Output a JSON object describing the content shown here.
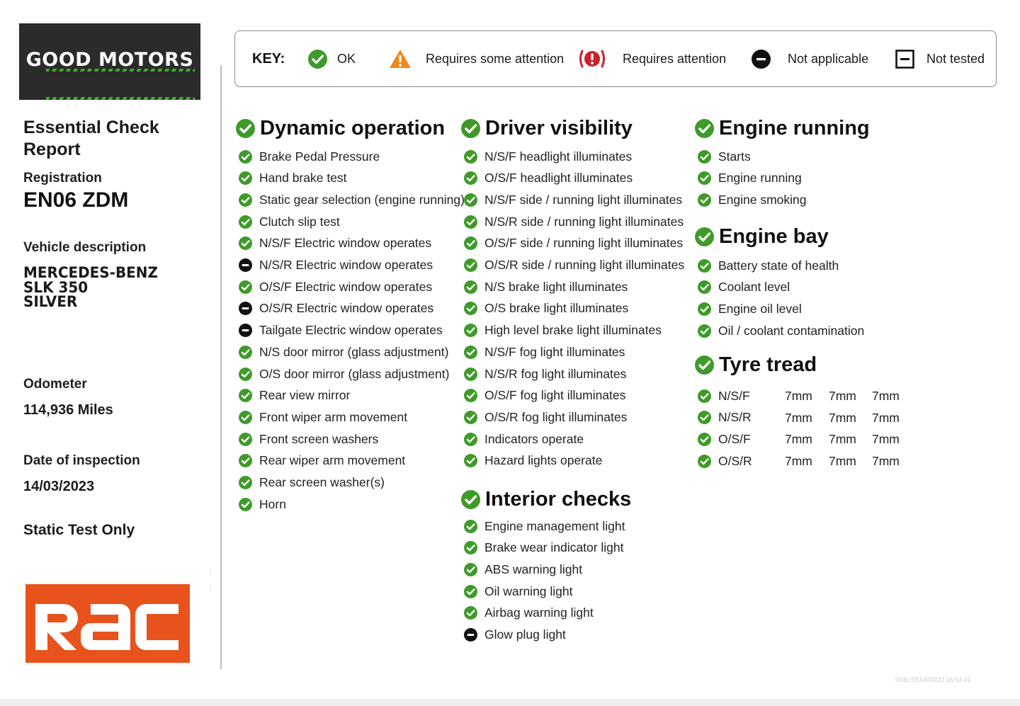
{
  "brand": {
    "logo_text": "GOOD MOTORS",
    "rac_logo_text": "RAC",
    "accent": "#3f9a2a",
    "rac_color": "#e8521c"
  },
  "report": {
    "title": "Essential Check Report",
    "registration_label": "Registration",
    "registration": "EN06 ZDM",
    "vehicle_label": "Vehicle description",
    "vehicle_lines": [
      "MERCEDES-BENZ",
      "SLK 350",
      "SILVER"
    ],
    "odometer_label": "Odometer",
    "odometer": "114,936 Miles",
    "date_label": "Date of inspection",
    "date": "14/03/2023",
    "test_type": "Static Test Only"
  },
  "key": {
    "title": "KEY:",
    "items": [
      {
        "icon": "ok-check-icon",
        "label": "OK"
      },
      {
        "icon": "warning-triangle-icon",
        "label": "Requires some attention"
      },
      {
        "icon": "alert-icon",
        "label": "Requires attention"
      },
      {
        "icon": "not-applicable-icon",
        "label": "Not applicable"
      },
      {
        "icon": "not-tested-icon",
        "label": "Not tested"
      }
    ]
  },
  "sections": {
    "dynamic": {
      "title": "Dynamic operation",
      "items": [
        {
          "label": "Brake Pedal Pressure",
          "status": "ok"
        },
        {
          "label": "Hand brake test",
          "status": "ok"
        },
        {
          "label": "Static gear selection (engine running)",
          "status": "ok"
        },
        {
          "label": "Clutch slip test",
          "status": "ok"
        },
        {
          "label": "N/S/F Electric window operates",
          "status": "ok"
        },
        {
          "label": "N/S/R Electric window operates",
          "status": "na"
        },
        {
          "label": "O/S/F Electric window operates",
          "status": "ok"
        },
        {
          "label": "O/S/R Electric window operates",
          "status": "na"
        },
        {
          "label": "Tailgate Electric window operates",
          "status": "na"
        },
        {
          "label": "N/S door mirror (glass adjustment)",
          "status": "ok"
        },
        {
          "label": "O/S door mirror (glass adjustment)",
          "status": "ok"
        },
        {
          "label": "Rear view mirror",
          "status": "ok"
        },
        {
          "label": "Front wiper arm movement",
          "status": "ok"
        },
        {
          "label": "Front screen washers",
          "status": "ok"
        },
        {
          "label": "Rear wiper arm movement",
          "status": "ok"
        },
        {
          "label": "Rear screen washer(s)",
          "status": "ok"
        },
        {
          "label": "Horn",
          "status": "ok"
        }
      ]
    },
    "visibility": {
      "title": "Driver visibility",
      "items": [
        {
          "label": "N/S/F headlight illuminates",
          "status": "ok"
        },
        {
          "label": "O/S/F headlight illuminates",
          "status": "ok"
        },
        {
          "label": "N/S/F side / running light illuminates",
          "status": "ok"
        },
        {
          "label": "N/S/R side / running light illuminates",
          "status": "ok"
        },
        {
          "label": "O/S/F side / running light illuminates",
          "status": "ok"
        },
        {
          "label": "O/S/R side / running light illuminates",
          "status": "ok"
        },
        {
          "label": "N/S brake light illuminates",
          "status": "ok"
        },
        {
          "label": "O/S brake light illuminates",
          "status": "ok"
        },
        {
          "label": "High level brake light illuminates",
          "status": "ok"
        },
        {
          "label": "N/S/F fog light illuminates",
          "status": "ok"
        },
        {
          "label": "N/S/R fog light illuminates",
          "status": "ok"
        },
        {
          "label": "O/S/F fog light illuminates",
          "status": "ok"
        },
        {
          "label": "O/S/R fog light illuminates",
          "status": "ok"
        },
        {
          "label": "Indicators operate",
          "status": "ok"
        },
        {
          "label": "Hazard lights operate",
          "status": "ok"
        }
      ]
    },
    "interior": {
      "title": "Interior checks",
      "items": [
        {
          "label": "Engine management light",
          "status": "ok"
        },
        {
          "label": "Brake wear indicator light",
          "status": "ok"
        },
        {
          "label": "ABS warning light",
          "status": "ok"
        },
        {
          "label": "Oil warning light",
          "status": "ok"
        },
        {
          "label": "Airbag warning light",
          "status": "ok"
        },
        {
          "label": "Glow plug light",
          "status": "na"
        }
      ]
    },
    "engine_running": {
      "title": "Engine running",
      "items": [
        {
          "label": "Starts",
          "status": "ok"
        },
        {
          "label": "Engine running",
          "status": "ok"
        },
        {
          "label": "Engine smoking",
          "status": "ok"
        }
      ]
    },
    "engine_bay": {
      "title": "Engine bay",
      "items": [
        {
          "label": "Battery state of health",
          "status": "ok"
        },
        {
          "label": "Coolant level",
          "status": "ok"
        },
        {
          "label": "Engine oil level",
          "status": "ok"
        },
        {
          "label": "Oil / coolant contamination",
          "status": "ok"
        }
      ]
    },
    "tyre": {
      "title": "Tyre tread",
      "rows": [
        {
          "label": "N/S/F",
          "status": "ok",
          "values": [
            "7mm",
            "7mm",
            "7mm"
          ]
        },
        {
          "label": "N/S/R",
          "status": "ok",
          "values": [
            "7mm",
            "7mm",
            "7mm"
          ]
        },
        {
          "label": "O/S/F",
          "status": "ok",
          "values": [
            "7mm",
            "7mm",
            "7mm"
          ]
        },
        {
          "label": "O/S/R",
          "status": "ok",
          "values": [
            "7mm",
            "7mm",
            "7mm"
          ]
        }
      ]
    }
  },
  "footer": {
    "stamp": "003LITE14/03/23 16:53:41"
  }
}
